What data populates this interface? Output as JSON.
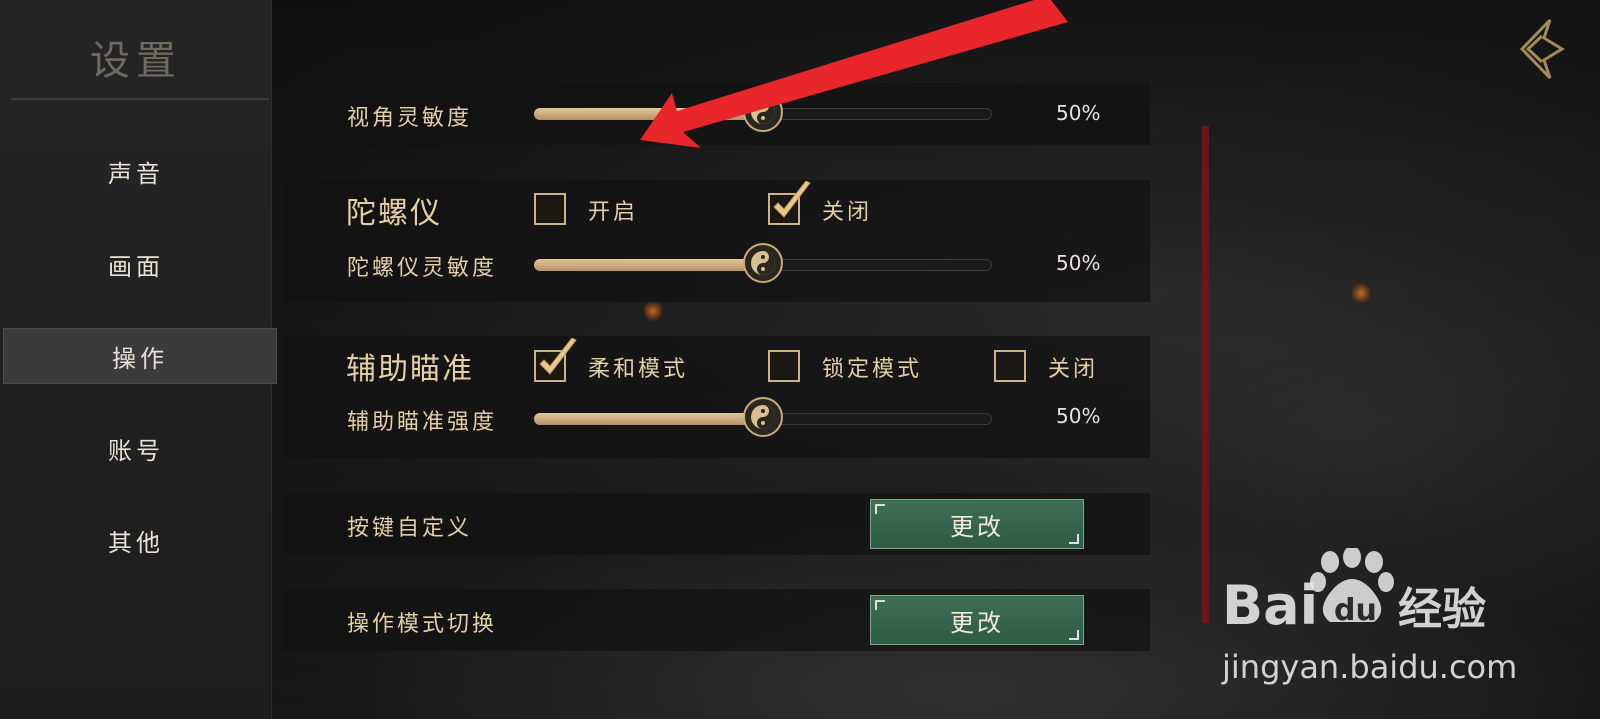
{
  "sidebar": {
    "title": "设置",
    "items": [
      {
        "label": "声音",
        "active": false
      },
      {
        "label": "画面",
        "active": false
      },
      {
        "label": "操作",
        "active": true
      },
      {
        "label": "账号",
        "active": false
      },
      {
        "label": "其他",
        "active": false
      }
    ]
  },
  "view_sensitivity": {
    "label": "视角灵敏度",
    "value": 50,
    "value_text": "50%"
  },
  "gyroscope": {
    "label": "陀螺仪",
    "options": [
      {
        "label": "开启",
        "checked": false
      },
      {
        "label": "关闭",
        "checked": true
      }
    ],
    "sensitivity": {
      "label": "陀螺仪灵敏度",
      "value": 50,
      "value_text": "50%"
    }
  },
  "aim_assist": {
    "label": "辅助瞄准",
    "options": [
      {
        "label": "柔和模式",
        "checked": true
      },
      {
        "label": "锁定模式",
        "checked": false
      },
      {
        "label": "关闭",
        "checked": false
      }
    ],
    "strength": {
      "label": "辅助瞄准强度",
      "value": 50,
      "value_text": "50%"
    }
  },
  "key_custom": {
    "label": "按键自定义",
    "button": "更改"
  },
  "mode_switch": {
    "label": "操作模式切换",
    "button": "更改"
  },
  "watermark": {
    "brand": "Bai du 经验",
    "url": "jingyan.baidu.com"
  },
  "colors": {
    "accent_gold": "#e3cfa5",
    "button_green": "#3f6f56",
    "arrow_red": "#e8262b",
    "scrollbar_red": "#6e1414"
  }
}
